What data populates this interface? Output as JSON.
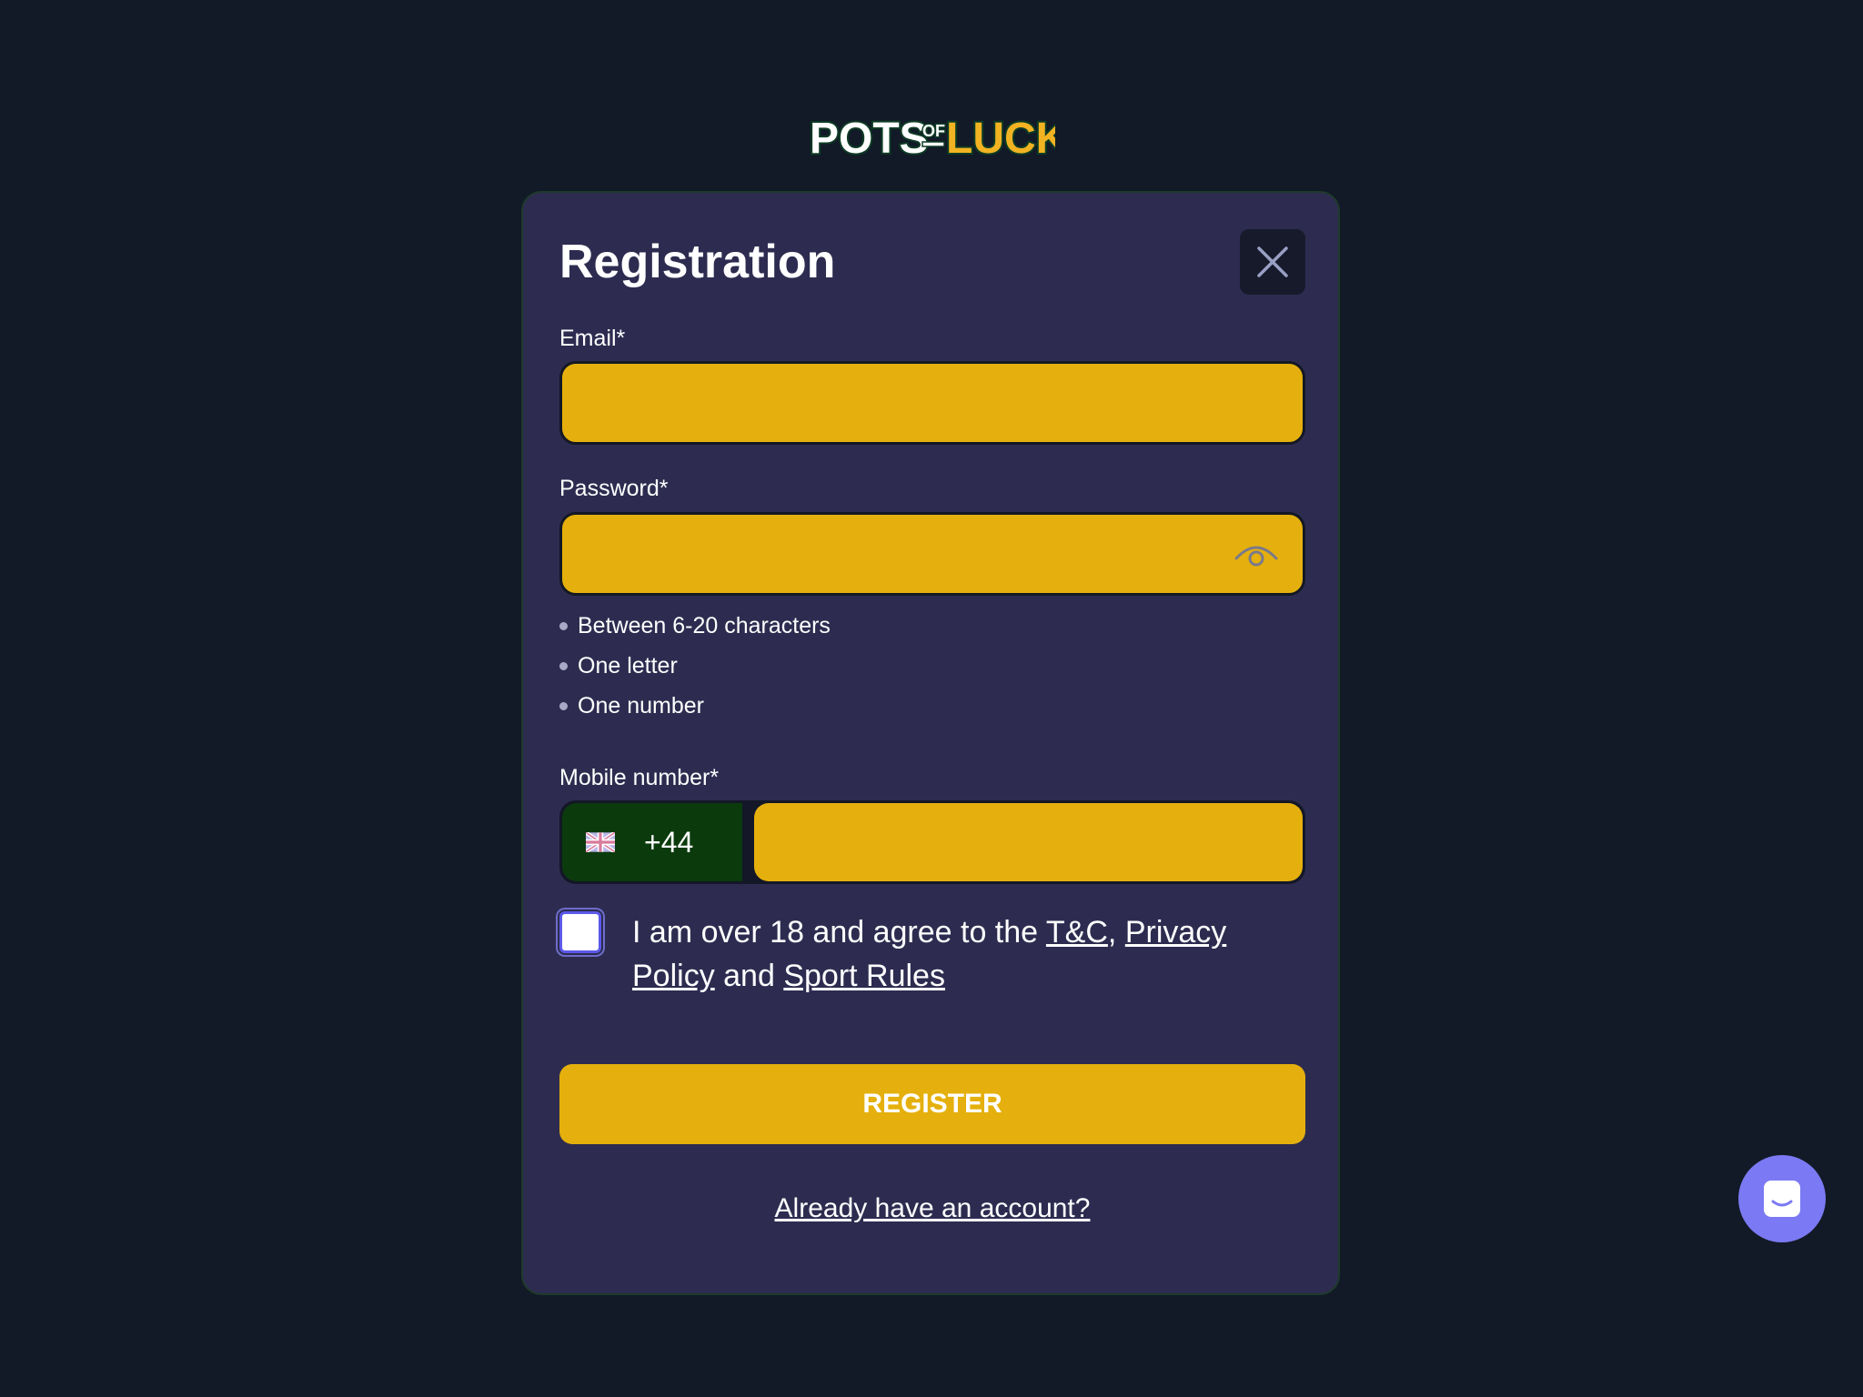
{
  "brand": {
    "logo_text_1": "POTS",
    "logo_text_2": "OF",
    "logo_text_3": "LUCK"
  },
  "modal": {
    "title": "Registration",
    "close_icon": "close-icon"
  },
  "form": {
    "email": {
      "label": "Email*",
      "value": "",
      "placeholder": ""
    },
    "password": {
      "label": "Password*",
      "value": "",
      "placeholder": "",
      "toggle_icon": "eye-icon",
      "rules": [
        "Between 6-20 characters",
        "One letter",
        "One number"
      ]
    },
    "mobile": {
      "label": "Mobile number*",
      "country_flag_icon": "uk-flag-icon",
      "dial_code": "+44",
      "value": "",
      "placeholder": ""
    },
    "agreement": {
      "checked": false,
      "text_1": "I am over 18 and agree to the ",
      "link_tc": "T&C",
      "text_2": ", ",
      "link_privacy": "Privacy Policy",
      "text_3": " and ",
      "link_sport_rules": "Sport Rules"
    },
    "register_label": "REGISTER",
    "login_link": "Already have an account?"
  },
  "chat": {
    "icon": "chat-icon"
  },
  "colors": {
    "background": "#111a26",
    "modal": "#2d2c50",
    "accent_yellow": "#e5b00d",
    "country_green": "#0b3a0d",
    "chat_purple": "#7b79f3"
  }
}
